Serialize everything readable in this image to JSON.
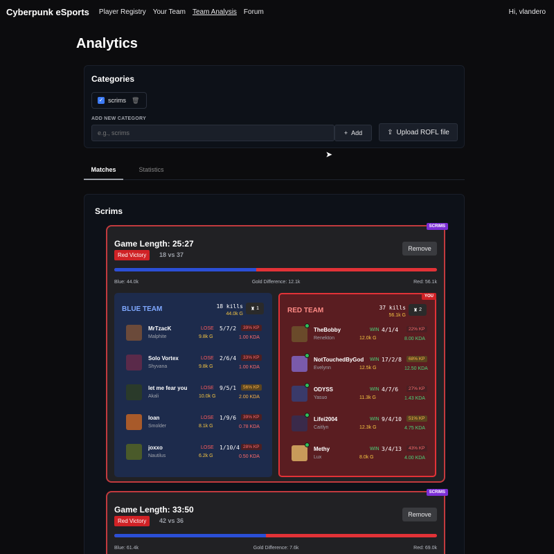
{
  "nav": {
    "brand": "Cyberpunk eSports",
    "links": [
      "Player Registry",
      "Your Team",
      "Team Analysis",
      "Forum"
    ],
    "greeting": "Hi, vlandero"
  },
  "page_title": "Analytics",
  "categories": {
    "title": "Categories",
    "chip_label": "scrims",
    "add_label": "ADD NEW CATEGORY",
    "input_placeholder": "e.g., scrims",
    "add_button": "Add",
    "upload_button": "Upload ROFL file"
  },
  "tabs": [
    "Matches",
    "Statistics"
  ],
  "scrims_title": "Scrims",
  "matches": [
    {
      "tag": "SCRIMS",
      "game_length": "Game Length: 25:27",
      "result": "Red Victory",
      "score": "18 vs 37",
      "remove": "Remove",
      "blue_gold_fraction": 0.44,
      "blue_gold": "Blue: 44.0k",
      "gold_diff": "Gold Difference: 12.1k",
      "red_gold": "Red: 56.1k",
      "blue_team": {
        "name": "BLUE TEAM",
        "kills": "18 kills",
        "gold": "44.0k G",
        "towers": "1",
        "players": [
          {
            "name": "MrTzacK",
            "champ": "Malphite",
            "result": "LOSE",
            "kda": "5/7/2",
            "gold": "9.8k G",
            "kp": "39% KP",
            "kp_color": "red",
            "kda_ratio": "1.00 KDA",
            "ratio_color": "red",
            "color": "#6b4a3a"
          },
          {
            "name": "Solo Vortex",
            "champ": "Shyvana",
            "result": "LOSE",
            "kda": "2/6/4",
            "gold": "9.8k G",
            "kp": "33% KP",
            "kp_color": "red",
            "kda_ratio": "1.00 KDA",
            "ratio_color": "red",
            "color": "#5a2a4a"
          },
          {
            "name": "let me fear you",
            "champ": "Akali",
            "result": "LOSE",
            "kda": "9/5/1",
            "gold": "10.0k G",
            "kp": "56% KP",
            "kp_color": "orange",
            "kda_ratio": "2.00 KDA",
            "ratio_color": "orange",
            "color": "#2a3a2a"
          },
          {
            "name": "loan",
            "champ": "Smolder",
            "result": "LOSE",
            "kda": "1/9/6",
            "gold": "8.1k G",
            "kp": "39% KP",
            "kp_color": "red",
            "kda_ratio": "0.78 KDA",
            "ratio_color": "red",
            "color": "#a85a2a"
          },
          {
            "name": "joxxo",
            "champ": "Nautilus",
            "result": "LOSE",
            "kda": "1/10/4",
            "gold": "6.2k G",
            "kp": "28% KP",
            "kp_color": "red",
            "kda_ratio": "0.50 KDA",
            "ratio_color": "red",
            "color": "#4a5a2a"
          }
        ]
      },
      "red_team": {
        "name": "RED TEAM",
        "kills": "37 kills",
        "gold": "56.1k G",
        "towers": "2",
        "you_tag": "YOU",
        "players": [
          {
            "name": "TheBobby",
            "champ": "Renekton",
            "result": "WIN",
            "kda": "4/1/4",
            "gold": "12.0k G",
            "kp": "22% KP",
            "kp_color": "red",
            "kda_ratio": "8.00 KDA",
            "ratio_color": "green",
            "color": "#6a4a2a"
          },
          {
            "name": "NotTouchedByGod",
            "champ": "Evelynn",
            "result": "WIN",
            "kda": "17/2/8",
            "gold": "12.5k G",
            "kp": "68% KP",
            "kp_color": "orange",
            "kda_ratio": "12.50 KDA",
            "ratio_color": "green",
            "color": "#7a5aaa"
          },
          {
            "name": "ODYSS",
            "champ": "Yasuo",
            "result": "WIN",
            "kda": "4/7/6",
            "gold": "11.3k G",
            "kp": "27% KP",
            "kp_color": "red",
            "kda_ratio": "1.43 KDA",
            "ratio_color": "green",
            "color": "#3a3a6a"
          },
          {
            "name": "Lifei2004",
            "champ": "Caitlyn",
            "result": "WIN",
            "kda": "9/4/10",
            "gold": "12.3k G",
            "kp": "51% KP",
            "kp_color": "orange",
            "kda_ratio": "4.75 KDA",
            "ratio_color": "green",
            "color": "#3a2a4a"
          },
          {
            "name": "Methy",
            "champ": "Lux",
            "result": "WIN",
            "kda": "3/4/13",
            "gold": "8.0k G",
            "kp": "43% KP",
            "kp_color": "red",
            "kda_ratio": "4.00 KDA",
            "ratio_color": "green",
            "color": "#c89a5a"
          }
        ]
      }
    },
    {
      "tag": "SCRIMS",
      "game_length": "Game Length: 33:50",
      "result": "Red Victory",
      "score": "42 vs 36",
      "remove": "Remove",
      "blue_gold_fraction": 0.47,
      "blue_gold": "Blue: 61.4k",
      "gold_diff": "Gold Difference: 7.6k",
      "red_gold": "Red: 69.0k"
    }
  ]
}
